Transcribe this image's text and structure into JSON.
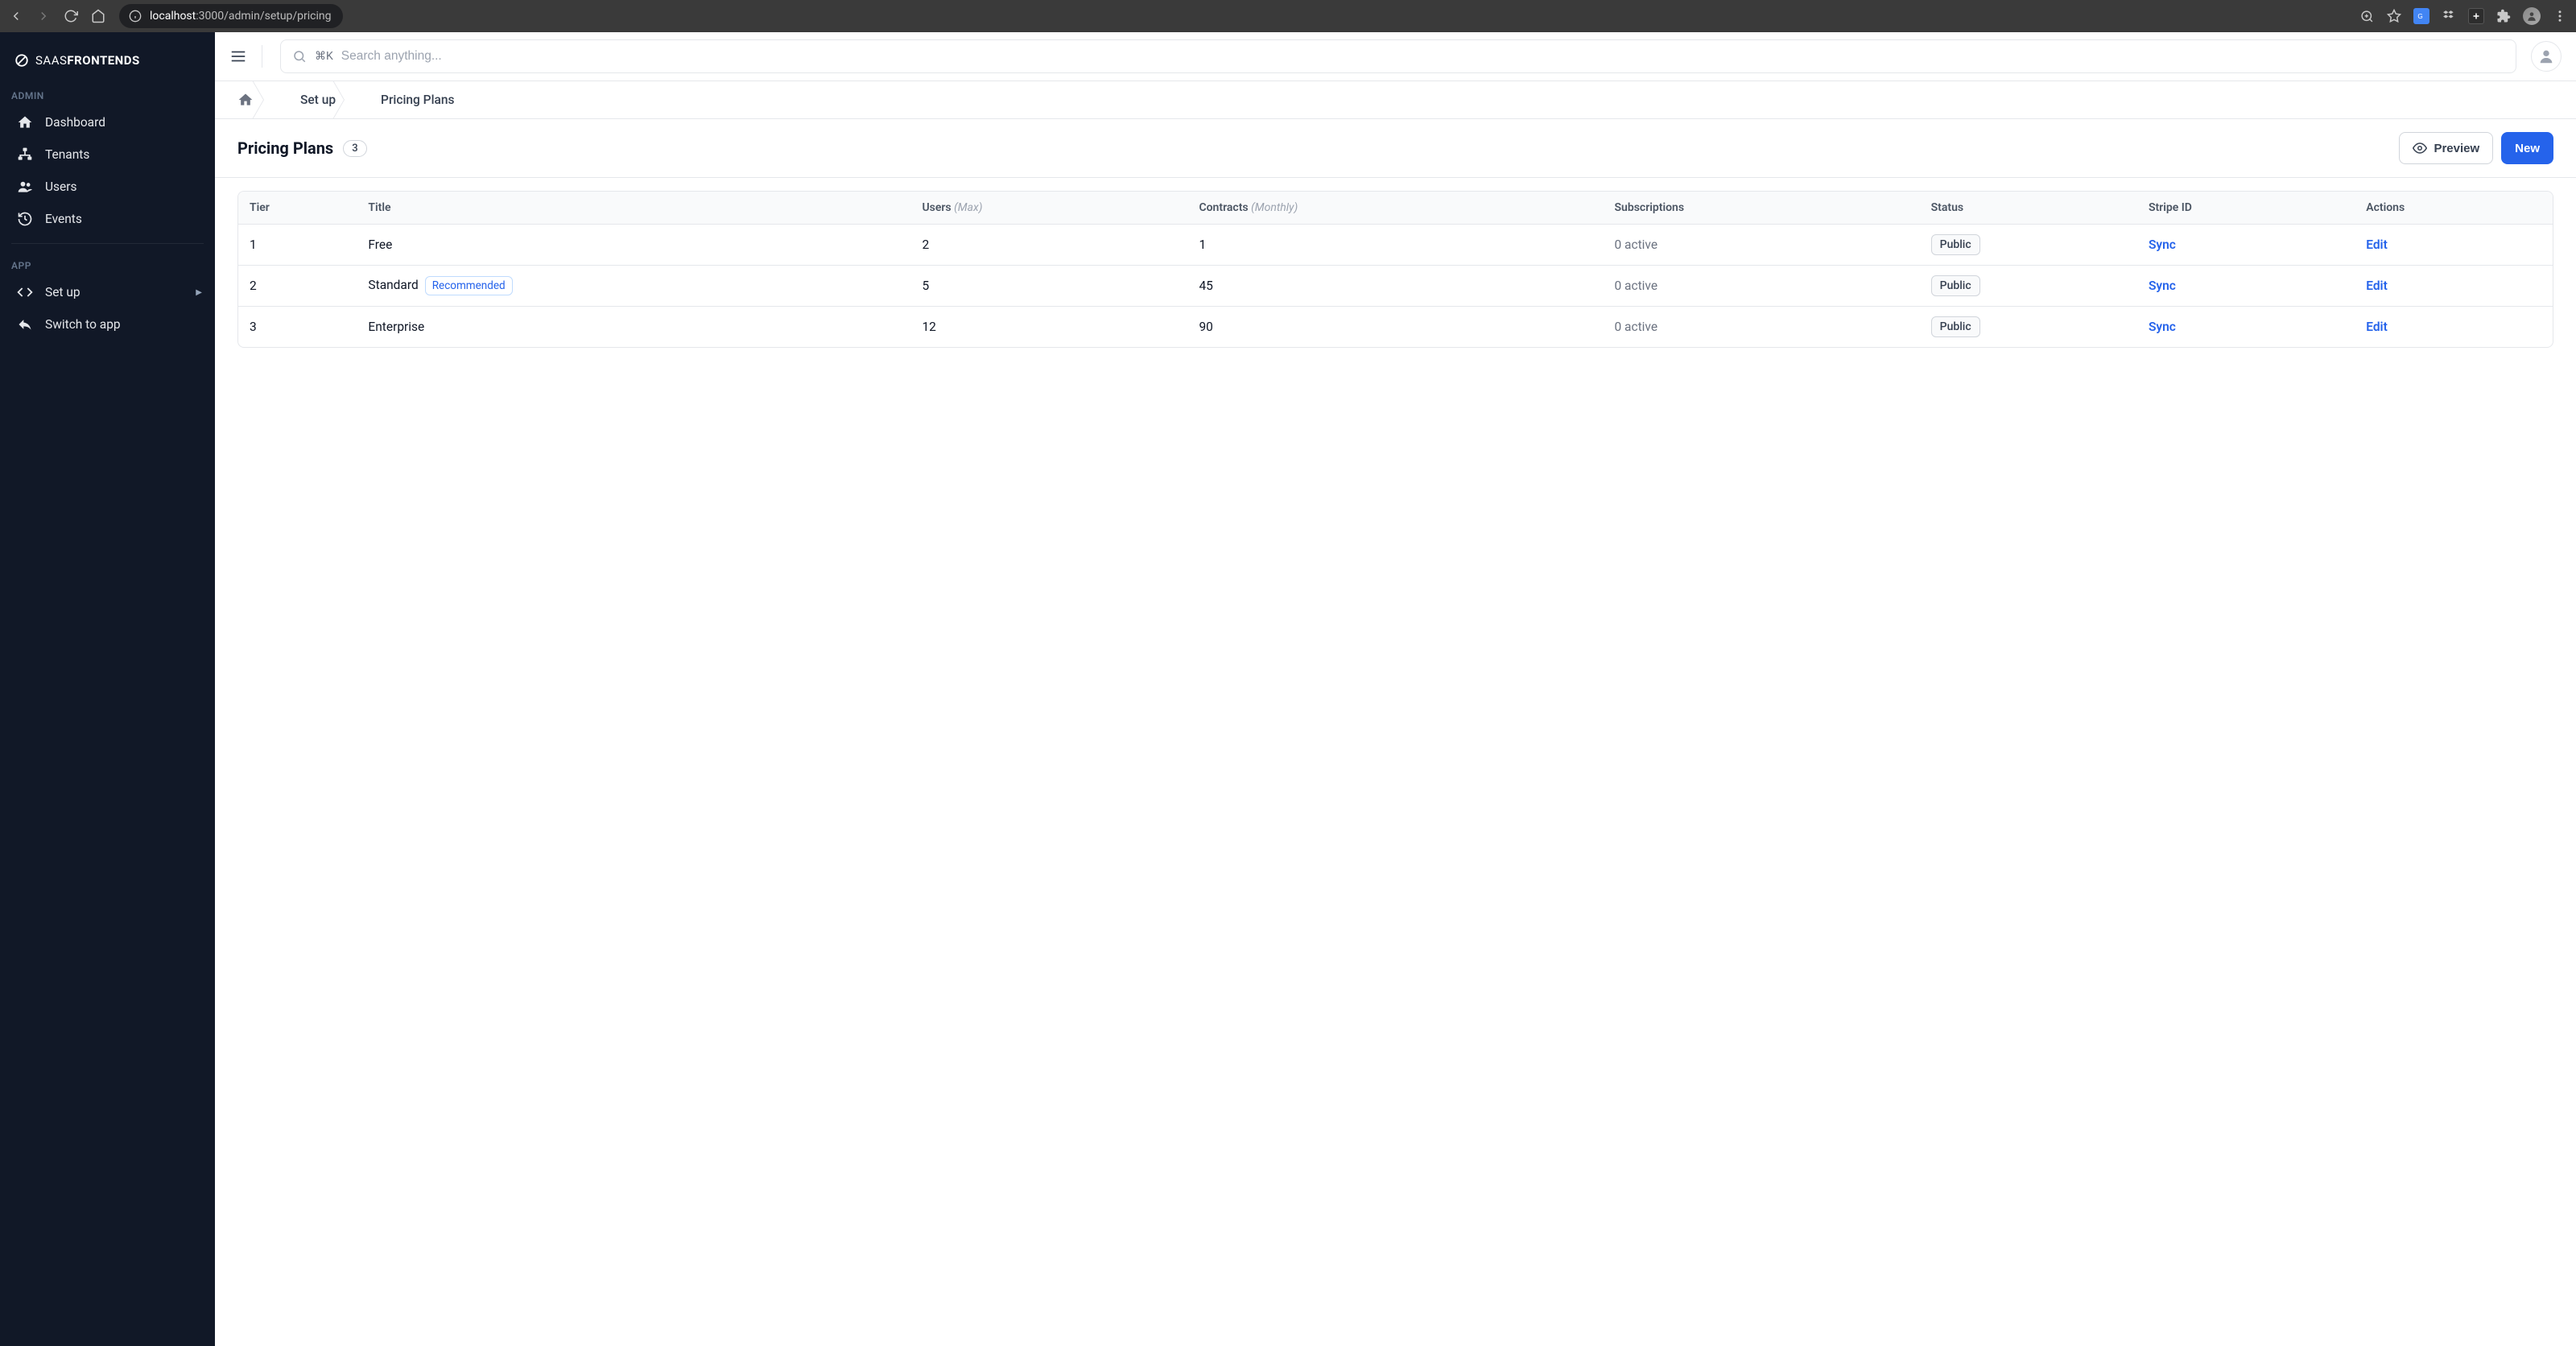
{
  "browser": {
    "url_proto_host": "localhost",
    "url_port_path": ":3000/admin/setup/pricing"
  },
  "brand": {
    "light": "SAAS",
    "bold": "FRONTENDS"
  },
  "sidebar": {
    "section_admin": "ADMIN",
    "section_app": "APP",
    "items_admin": [
      {
        "label": "Dashboard"
      },
      {
        "label": "Tenants"
      },
      {
        "label": "Users"
      },
      {
        "label": "Events"
      }
    ],
    "items_app": [
      {
        "label": "Set up"
      },
      {
        "label": "Switch to app"
      }
    ]
  },
  "search": {
    "shortcut": "⌘K",
    "placeholder": "Search anything..."
  },
  "breadcrumb": {
    "setup": "Set up",
    "page": "Pricing Plans"
  },
  "page": {
    "title": "Pricing Plans",
    "count": "3",
    "preview_label": "Preview",
    "new_label": "New"
  },
  "table": {
    "headers": {
      "tier": "Tier",
      "title": "Title",
      "users": "Users",
      "users_hint": "(Max)",
      "contracts": "Contracts",
      "contracts_hint": "(Monthly)",
      "subscriptions": "Subscriptions",
      "status": "Status",
      "stripe": "Stripe ID",
      "actions": "Actions"
    },
    "recommended_label": "Recommended",
    "sync_label": "Sync",
    "edit_label": "Edit",
    "rows": [
      {
        "tier": "1",
        "title": "Free",
        "recommended": false,
        "users": "2",
        "contracts": "1",
        "subscriptions": "0 active",
        "status": "Public"
      },
      {
        "tier": "2",
        "title": "Standard",
        "recommended": true,
        "users": "5",
        "contracts": "45",
        "subscriptions": "0 active",
        "status": "Public"
      },
      {
        "tier": "3",
        "title": "Enterprise",
        "recommended": false,
        "users": "12",
        "contracts": "90",
        "subscriptions": "0 active",
        "status": "Public"
      }
    ]
  }
}
